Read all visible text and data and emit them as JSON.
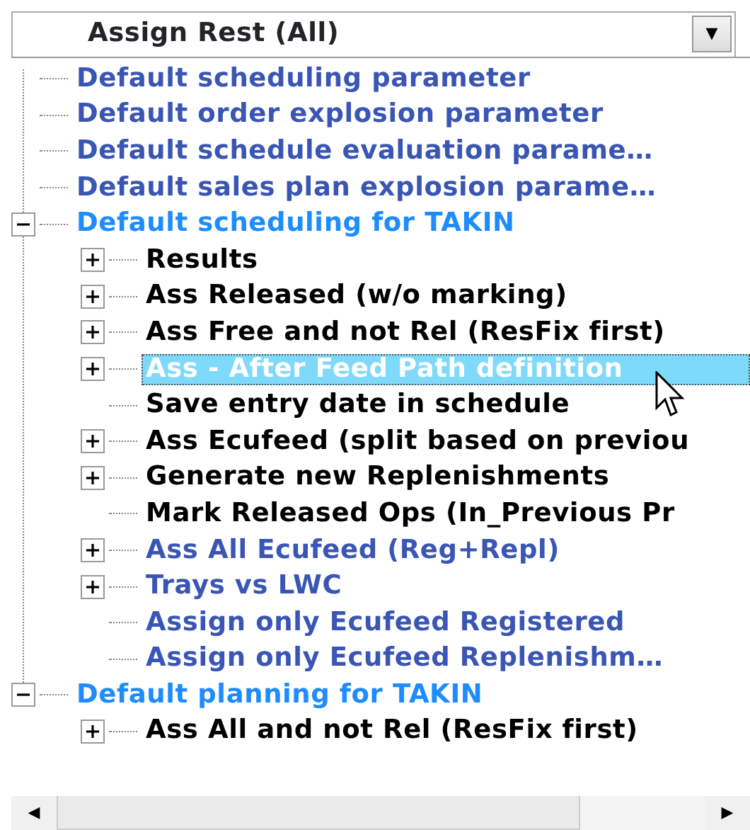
{
  "combo": {
    "value": "Assign Rest (All)",
    "arrow": "▼"
  },
  "tree": [
    {
      "label": "Default scheduling parameter",
      "color": "#3a56b4",
      "selected": false
    },
    {
      "label": "Default order explosion parameter",
      "color": "#3a56b4",
      "selected": false
    },
    {
      "label": "Default schedule evaluation parame…",
      "color": "#3a56b4",
      "selected": false
    },
    {
      "label": "Default sales plan explosion parame…",
      "color": "#3a56b4",
      "selected": false
    },
    {
      "label": "Default scheduling for TAKIN",
      "color": "#1e8cff",
      "selected": false,
      "expanded": true,
      "children": [
        {
          "label": "Results",
          "color": "#000000",
          "selected": false,
          "expanded": false
        },
        {
          "label": "Ass Released (w/o marking)",
          "color": "#000000",
          "selected": false,
          "expanded": false
        },
        {
          "label": "Ass Free and not Rel (ResFix first)",
          "color": "#000000",
          "selected": false,
          "expanded": false
        },
        {
          "label": "Ass - After Feed Path definition",
          "selected": true,
          "expanded": false
        },
        {
          "label": "Save entry date in schedule",
          "color": "#000000",
          "selected": false
        },
        {
          "label": "Ass Ecufeed (split based on previou",
          "color": "#000000",
          "selected": false,
          "expanded": false
        },
        {
          "label": "Generate new Replenishments",
          "color": "#000000",
          "selected": false,
          "expanded": false
        },
        {
          "label": "Mark Released Ops (In_Previous Pr",
          "color": "#000000",
          "selected": false
        },
        {
          "label": "Ass All Ecufeed (Reg+Repl)",
          "color": "#3a56b4",
          "selected": false,
          "expanded": false
        },
        {
          "label": "Trays vs LWC",
          "color": "#3a56b4",
          "selected": false,
          "expanded": false
        },
        {
          "label": "Assign only Ecufeed Registered",
          "color": "#3a56b4",
          "selected": false
        },
        {
          "label": "Assign only Ecufeed Replenishm…",
          "color": "#3a56b4",
          "selected": false
        }
      ]
    },
    {
      "label": "Default planning for TAKIN",
      "color": "#1e8cff",
      "selected": false,
      "expanded": true,
      "children": [
        {
          "label": "Ass All and not Rel (ResFix first)",
          "color": "#000000",
          "selected": false,
          "expanded": false
        }
      ]
    }
  ],
  "scrollbar": {
    "left": "◀",
    "right": "▶"
  }
}
